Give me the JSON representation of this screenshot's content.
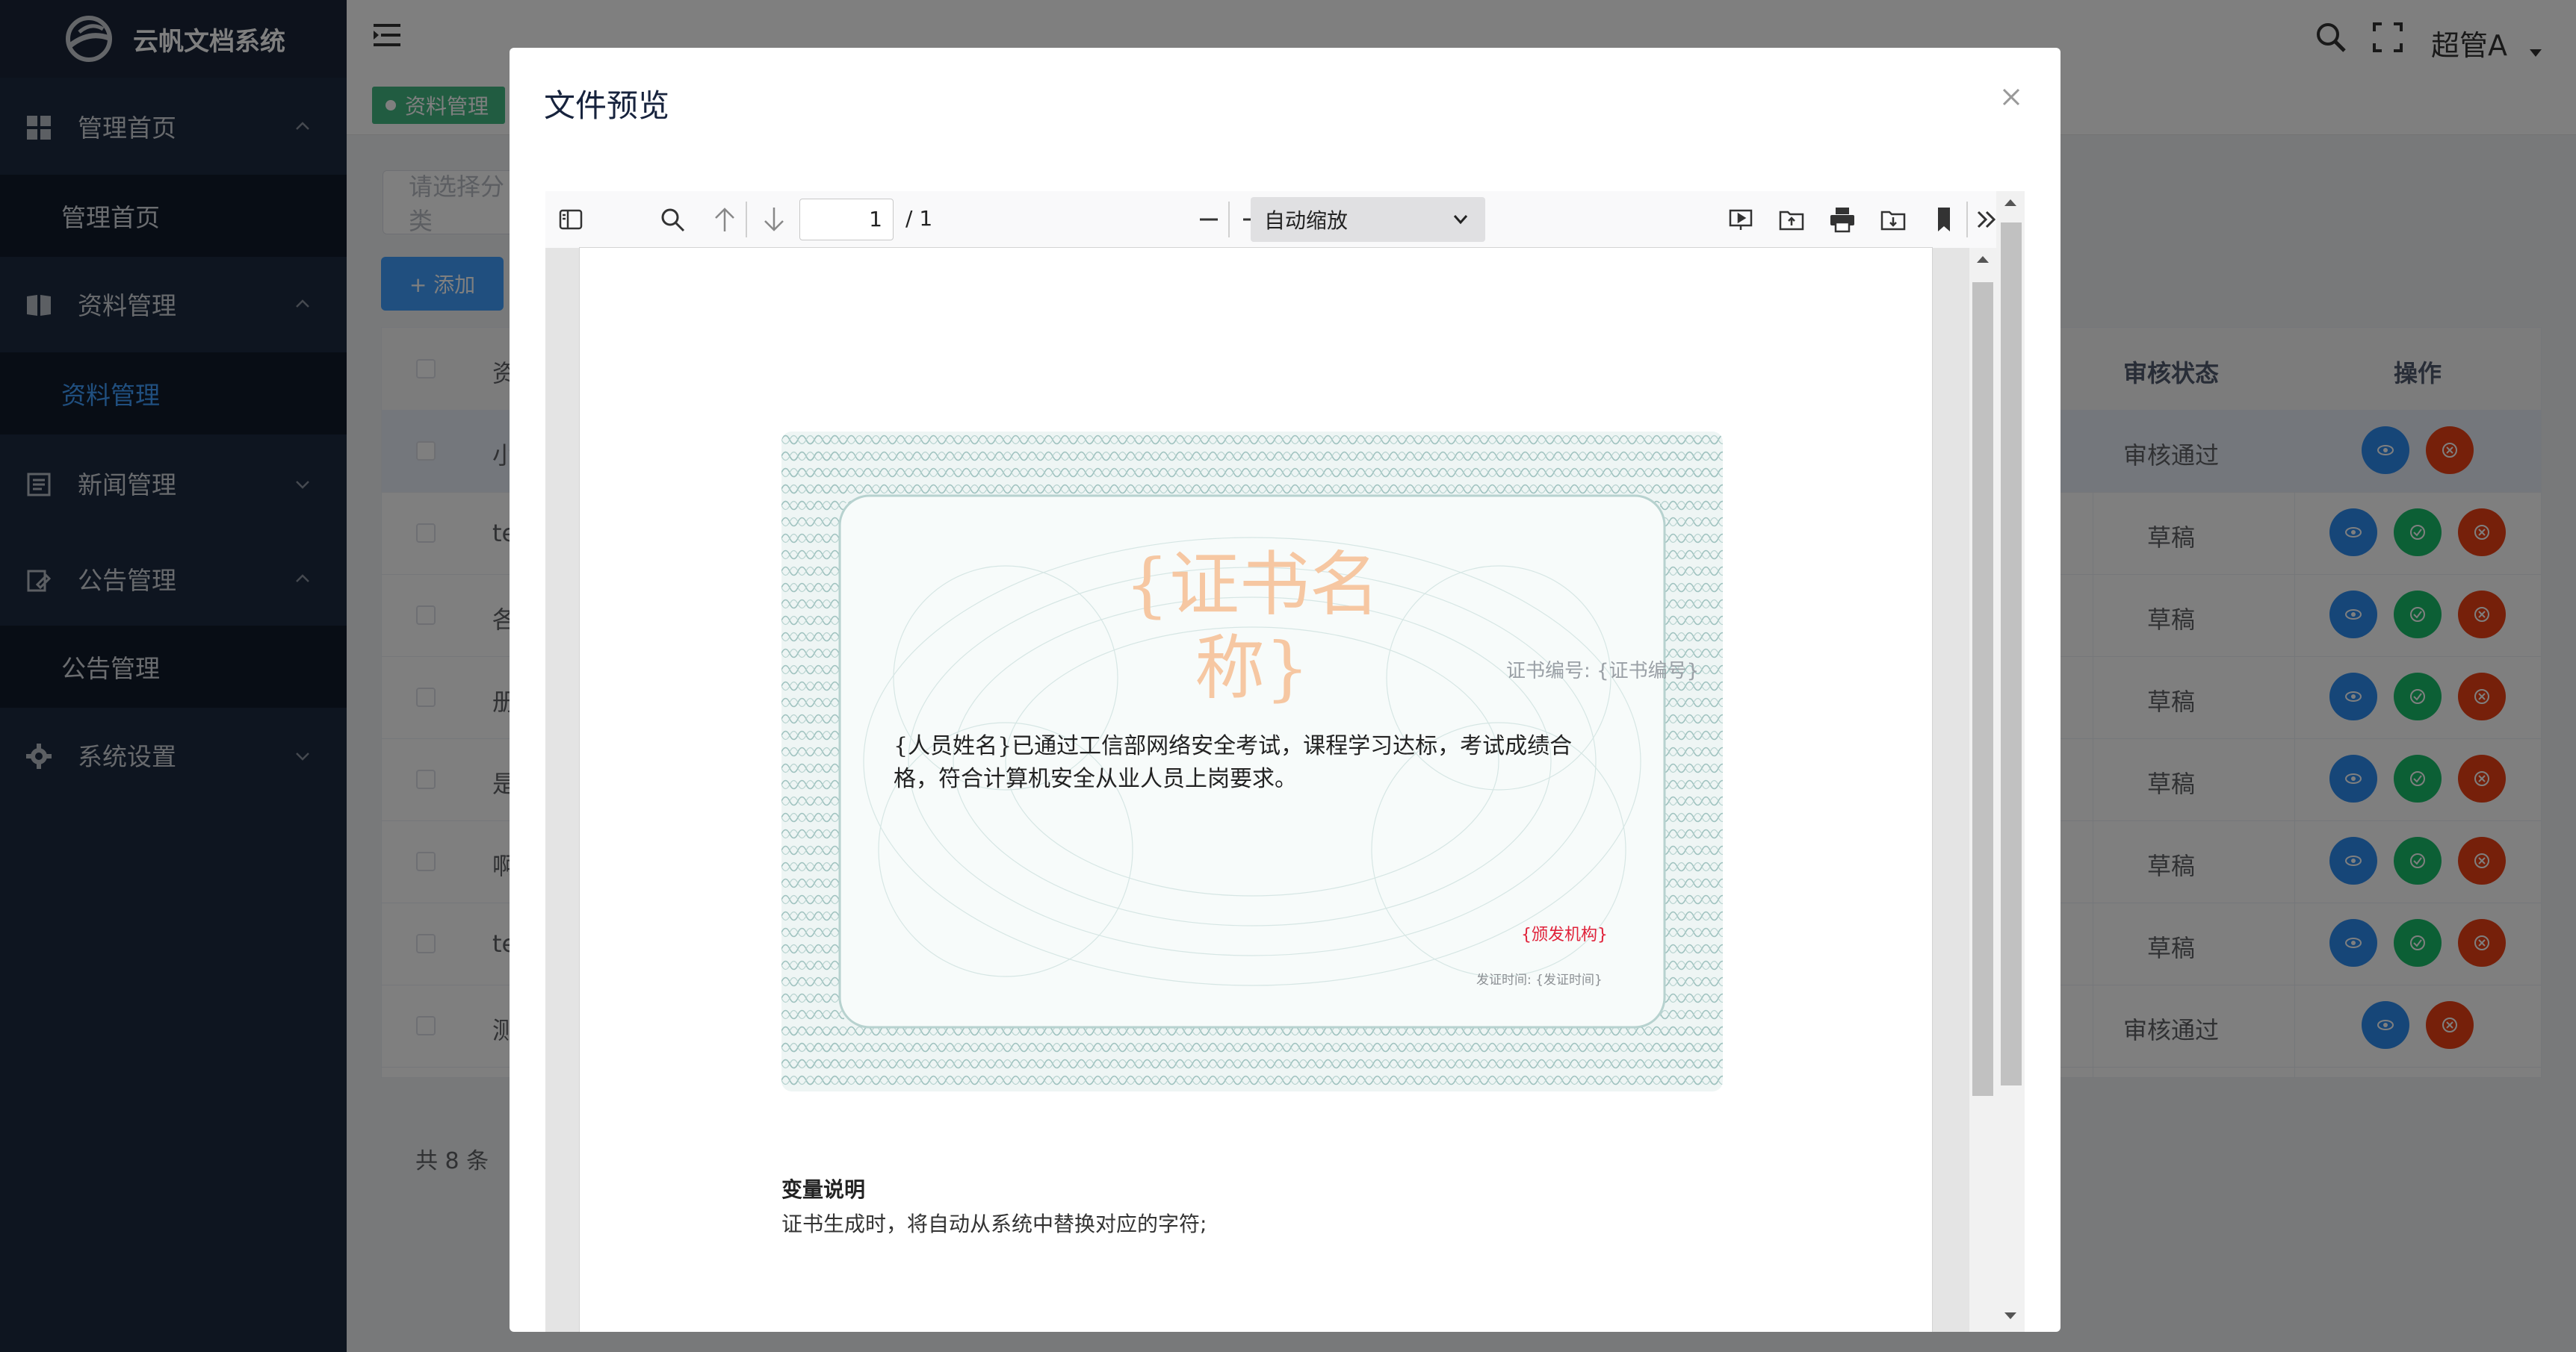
{
  "app": {
    "name": "云帆文档系统",
    "user": "超管A"
  },
  "sidebar": {
    "groups": [
      {
        "label": "管理首页",
        "icon": "dashboard-icon",
        "expanded": true,
        "children": [
          {
            "label": "管理首页",
            "active": false
          }
        ]
      },
      {
        "label": "资料管理",
        "icon": "book-icon",
        "expanded": true,
        "children": [
          {
            "label": "资料管理",
            "active": true
          }
        ]
      },
      {
        "label": "新闻管理",
        "icon": "news-icon",
        "expanded": false,
        "children": []
      },
      {
        "label": "公告管理",
        "icon": "notice-icon",
        "expanded": true,
        "children": [
          {
            "label": "公告管理",
            "active": false
          }
        ]
      },
      {
        "label": "系统设置",
        "icon": "gear-icon",
        "expanded": false,
        "children": []
      }
    ]
  },
  "breadcrumb": {
    "tag": "资料管理"
  },
  "toolbar": {
    "filter_placeholder": "请选择分类",
    "add_label": "+ 添加"
  },
  "table": {
    "headers": {
      "first": "资",
      "status": "审核状态",
      "operation": "操作"
    },
    "rows": [
      {
        "first": "小",
        "status": "审核通过",
        "actions": [
          "view",
          "delete"
        ],
        "selected": true
      },
      {
        "first": "te",
        "status": "草稿",
        "actions": [
          "view",
          "approve",
          "delete"
        ],
        "selected": false
      },
      {
        "first": "各",
        "status": "草稿",
        "actions": [
          "view",
          "approve",
          "delete"
        ],
        "selected": false
      },
      {
        "first": "册",
        "status": "草稿",
        "actions": [
          "view",
          "approve",
          "delete"
        ],
        "selected": false
      },
      {
        "first": "是",
        "status": "草稿",
        "actions": [
          "view",
          "approve",
          "delete"
        ],
        "selected": false
      },
      {
        "first": "啊",
        "status": "草稿",
        "actions": [
          "view",
          "approve",
          "delete"
        ],
        "selected": false
      },
      {
        "first": "te",
        "status": "草稿",
        "actions": [
          "view",
          "approve",
          "delete"
        ],
        "selected": false
      },
      {
        "first": "测",
        "status": "审核通过",
        "actions": [
          "view",
          "delete"
        ],
        "selected": false
      }
    ],
    "total": "共 8 条"
  },
  "modal": {
    "title": "文件预览",
    "viewer": {
      "page_current": "1",
      "page_total": "/ 1",
      "zoom": "自动缩放"
    },
    "certificate": {
      "title_line1": "{证书名",
      "title_line2": "称}",
      "cert_no": "证书编号: {证书编号}",
      "body": "{人员姓名}已通过工信部网络安全考试，课程学习达标，考试成绩合格，符合计算机安全从业人员上岗要求。",
      "org": "{颁发机构}",
      "date": "发证时间: {发证时间}"
    },
    "variables": {
      "title": "变量说明",
      "desc": "证书生成时，将自动从系统中替换对应的字符;"
    }
  },
  "colors": {
    "sidebar_bg": "#1d2a40",
    "accent": "#409eff",
    "tag_green": "#42b983",
    "view_btn": "#2d8cf0",
    "approve_btn": "#19be6b",
    "delete_btn": "#ed4014",
    "cert_title": "#f6c7a2",
    "cert_org": "#e0223a"
  }
}
